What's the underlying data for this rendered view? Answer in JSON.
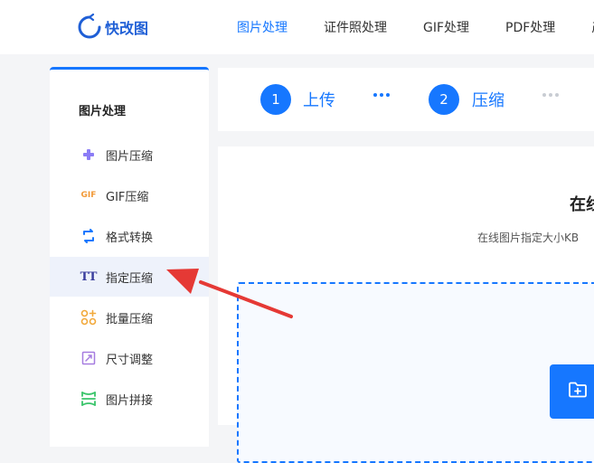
{
  "header": {
    "logo_text": "快改图",
    "nav": [
      {
        "label": "图片处理",
        "active": true
      },
      {
        "label": "证件照处理",
        "active": false
      },
      {
        "label": "GIF处理",
        "active": false
      },
      {
        "label": "PDF处理",
        "active": false
      },
      {
        "label": "产",
        "active": false
      }
    ]
  },
  "sidebar": {
    "title": "图片处理",
    "items": [
      {
        "label": "图片压缩",
        "icon": "compress-plus-icon"
      },
      {
        "label": "GIF压缩",
        "icon": "gif-icon",
        "icon_text": "GIF"
      },
      {
        "label": "格式转换",
        "icon": "convert-icon"
      },
      {
        "label": "指定压缩",
        "icon": "text-size-icon",
        "icon_text": "TT",
        "selected": true
      },
      {
        "label": "批量压缩",
        "icon": "batch-icon"
      },
      {
        "label": "尺寸调整",
        "icon": "resize-icon"
      },
      {
        "label": "图片拼接",
        "icon": "stitch-icon"
      }
    ]
  },
  "steps": [
    {
      "number": "1",
      "label": "上传"
    },
    {
      "number": "2",
      "label": "压缩"
    }
  ],
  "main": {
    "title": "在线",
    "subtitle": "在线图片指定大小KB"
  },
  "colors": {
    "accent": "#1677ff",
    "annotation": "#e53935"
  }
}
